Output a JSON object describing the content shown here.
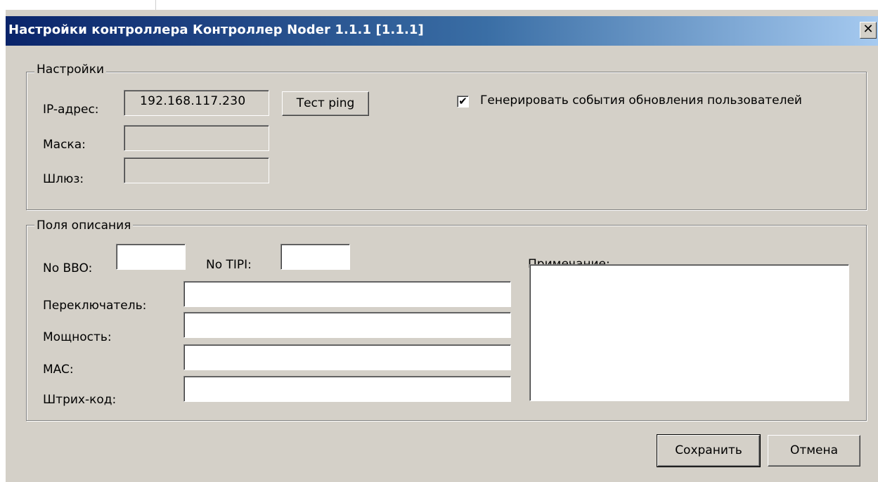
{
  "window": {
    "title": "Настройки контроллера Контроллер Noder 1.1.1 [1.1.1]",
    "close_glyph": "✕"
  },
  "settings": {
    "legend": "Настройки",
    "ip_label": "IP-адрес:",
    "ip_value": "192.168.117.230",
    "ping_button": "Тест ping",
    "mask_label": "Маска:",
    "mask_value": "",
    "gateway_label": "Шлюз:",
    "gateway_value": "",
    "generate_events_checked": true,
    "checkbox_glyph": "✔",
    "generate_events_label": "Генерировать события обновления пользователей"
  },
  "description": {
    "legend": "Поля описания",
    "bbo_label": "No BBO:",
    "bbo_value": "",
    "tipi_label": "No TIPI:",
    "tipi_value": "",
    "switch_label": "Переключатель:",
    "switch_value": "",
    "power_label": "Мощность:",
    "power_value": "",
    "mac_label": "MAC:",
    "mac_value": "",
    "barcode_label": "Штрих-код:",
    "barcode_value": "",
    "note_label": "Примечание:",
    "note_value": ""
  },
  "buttons": {
    "save": "Сохранить",
    "cancel": "Отмена"
  },
  "colors": {
    "dialog_bg": "#d4d0c8",
    "titlebar_start": "#0a246a",
    "titlebar_end": "#a6caf0"
  }
}
